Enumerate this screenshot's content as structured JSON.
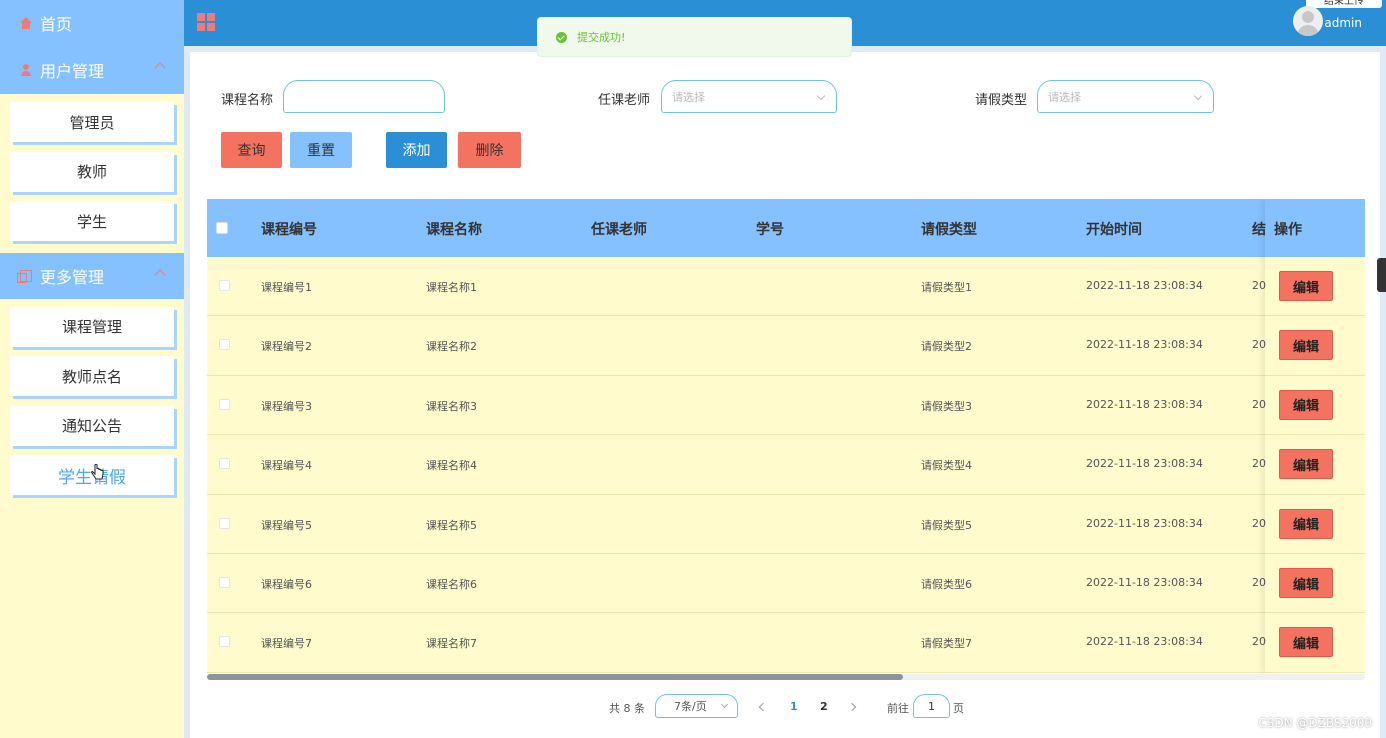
{
  "sidebar": {
    "home": "首页",
    "groups": [
      {
        "label": "用户管理",
        "items": [
          "管理员",
          "教师",
          "学生"
        ]
      },
      {
        "label": "更多管理",
        "items": [
          "课程管理",
          "教师点名",
          "通知公告",
          "学生请假"
        ]
      }
    ]
  },
  "header": {
    "username": "admin",
    "corner_text": "结束上传"
  },
  "toast": {
    "message": "提交成功!"
  },
  "filters": {
    "course_name_label": "课程名称",
    "course_name_value": "",
    "teacher_label": "任课老师",
    "teacher_placeholder": "请选择",
    "leave_type_label": "请假类型",
    "leave_type_placeholder": "请选择"
  },
  "buttons": {
    "search": "查询",
    "reset": "重置",
    "add": "添加",
    "delete": "删除"
  },
  "table": {
    "columns": [
      "课程编号",
      "课程名称",
      "任课老师",
      "学号",
      "请假类型",
      "开始时间",
      "结",
      "操作"
    ],
    "rows": [
      {
        "course_no": "课程编号1",
        "course_name": "课程名称1",
        "teacher": "",
        "student_no": "",
        "leave_type": "请假类型1",
        "start": "2022-11-18 23:08:34",
        "end_partial": "20"
      },
      {
        "course_no": "课程编号2",
        "course_name": "课程名称2",
        "teacher": "",
        "student_no": "",
        "leave_type": "请假类型2",
        "start": "2022-11-18 23:08:34",
        "end_partial": "20"
      },
      {
        "course_no": "课程编号3",
        "course_name": "课程名称3",
        "teacher": "",
        "student_no": "",
        "leave_type": "请假类型3",
        "start": "2022-11-18 23:08:34",
        "end_partial": "20"
      },
      {
        "course_no": "课程编号4",
        "course_name": "课程名称4",
        "teacher": "",
        "student_no": "",
        "leave_type": "请假类型4",
        "start": "2022-11-18 23:08:34",
        "end_partial": "20"
      },
      {
        "course_no": "课程编号5",
        "course_name": "课程名称5",
        "teacher": "",
        "student_no": "",
        "leave_type": "请假类型5",
        "start": "2022-11-18 23:08:34",
        "end_partial": "20"
      },
      {
        "course_no": "课程编号6",
        "course_name": "课程名称6",
        "teacher": "",
        "student_no": "",
        "leave_type": "请假类型6",
        "start": "2022-11-18 23:08:34",
        "end_partial": "20"
      },
      {
        "course_no": "课程编号7",
        "course_name": "课程名称7",
        "teacher": "",
        "student_no": "",
        "leave_type": "请假类型7",
        "start": "2022-11-18 23:08:34",
        "end_partial": "20"
      }
    ],
    "edit_label": "编辑"
  },
  "pagination": {
    "total": "共 8 条",
    "page_size": "7条/页",
    "pages": [
      "1",
      "2"
    ],
    "current_page": "1",
    "goto_prefix": "前往",
    "goto_value": "1",
    "goto_suffix": "页"
  },
  "watermark": "CSDN @DZBS2000",
  "colors": {
    "sidebar_bg": "#fffbcc",
    "accent_blue": "#85c1ff",
    "header_blue": "#2a8fd4",
    "btn_red": "#f47360"
  }
}
